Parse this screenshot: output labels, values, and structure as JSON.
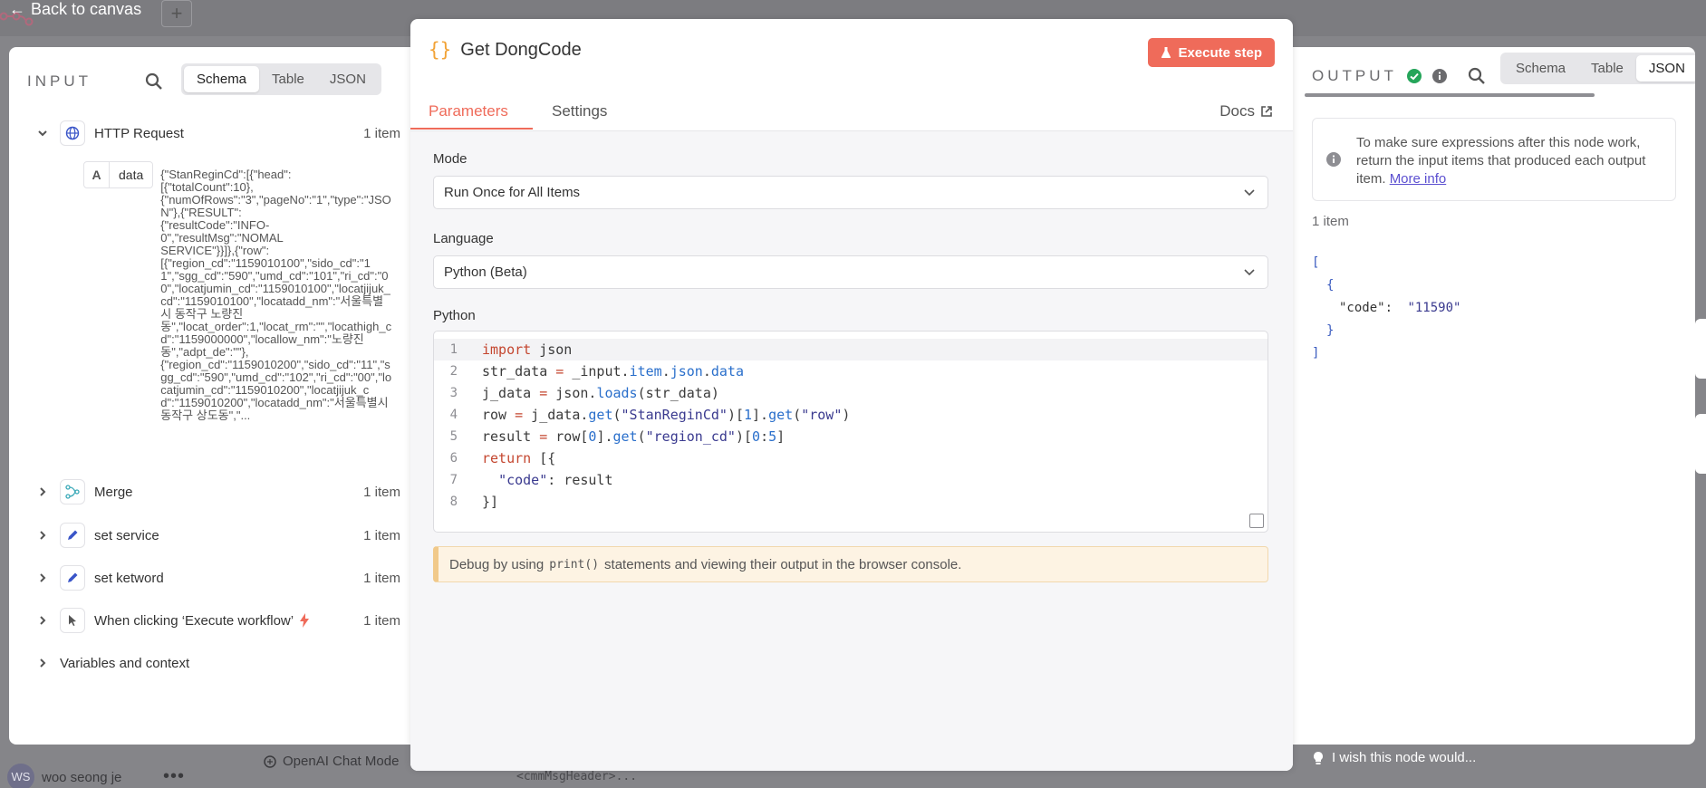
{
  "backdrop": {
    "back_label": "Back to canvas",
    "user_initials": "WS",
    "user_name": "woo seong je",
    "more_label": "•••",
    "openai_node": "OpenAI Chat Mode",
    "snippet": "<cmmMsgHeader>..."
  },
  "input": {
    "title": "INPUT",
    "tabs": [
      "Schema",
      "Table",
      "JSON"
    ],
    "active_tab": "Schema",
    "nodes": [
      {
        "label": "HTTP Request",
        "count": "1 item",
        "icon": "globe-icon",
        "expanded": true
      },
      {
        "label": "Merge",
        "count": "1 item",
        "icon": "merge-icon"
      },
      {
        "label": "set service",
        "count": "1 item",
        "icon": "pencil-icon"
      },
      {
        "label": "set ketword",
        "count": "1 item",
        "icon": "pencil-icon"
      },
      {
        "label": "When clicking ‘Execute workflow’",
        "count": "1 item",
        "icon": "cursor-icon"
      }
    ],
    "field": {
      "type": "A",
      "name": "data",
      "value": "{\"StanReginCd\":[{\"head\":\n[{\"totalCount\":10},\n{\"numOfRows\":\"3\",\"pageNo\":\"1\",\"type\":\"JSON\"},{\"RESULT\":\n{\"resultCode\":\"INFO-\n0\",\"resultMsg\":\"NOMAL\nSERVICE\"}}]},{\"row\":\n[{\"region_cd\":\"1159010100\",\"sido_cd\":\"11\",\"sgg_cd\":\"590\",\"umd_cd\":\"101\",\"ri_cd\":\"00\",\"locatjumin_cd\":\"1159010100\",\"locatjijuk_cd\":\"1159010100\",\"locatadd_nm\":\"서울특별시 동작구 노량진\n동\",\"locat_order\":1,\"locat_rm\":\"\",\"locathigh_cd\":\"1159000000\",\"locallow_nm\":\"노량진동\",\"adpt_de\":\"\"},\n{\"region_cd\":\"1159010200\",\"sido_cd\":\"11\",\"sgg_cd\":\"590\",\"umd_cd\":\"102\",\"ri_cd\":\"00\",\"locatjumin_cd\":\"1159010200\",\"locatjijuk_cd\":\"1159010200\",\"locatadd_nm\":\"서울특별시 동작구 상도동\",\"..."
    },
    "variables_label": "Variables and context"
  },
  "node": {
    "title": "Get DongCode",
    "execute_label": "Execute step",
    "tabs": [
      "Parameters",
      "Settings"
    ],
    "docs_label": "Docs",
    "mode_label": "Mode",
    "mode_value": "Run Once for All Items",
    "language_label": "Language",
    "language_value": "Python (Beta)",
    "code_label": "Python",
    "code_lines": [
      "import json",
      "str_data = _input.item.json.data",
      "j_data = json.loads(str_data)",
      "row = j_data.get(\"StanReginCd\")[1].get(\"row\")",
      "result = row[0].get(\"region_cd\")[0:5]",
      "return [{",
      "  \"code\": result",
      "}]"
    ],
    "debug_prefix": "Debug by using",
    "debug_code": "print()",
    "debug_suffix": "statements and viewing their output in the browser console."
  },
  "output": {
    "title": "OUTPUT",
    "tabs": [
      "Schema",
      "Table",
      "JSON"
    ],
    "active_tab": "JSON",
    "info_text": "To make sure expressions after this node work, return the input items that produced each output item.",
    "info_link": "More info",
    "count": "1 item",
    "json_key": "\"code\":",
    "json_value": "\"11590\"",
    "json_open": "[",
    "json_obj_open": "{",
    "json_obj_close": "}",
    "json_close": "]"
  },
  "feedback": {
    "label": "I wish this node would..."
  },
  "colors": {
    "accent": "#ef6b5a",
    "success": "#25a55a",
    "link": "#5b4fd0",
    "warning_bg": "#fdf3e3"
  }
}
